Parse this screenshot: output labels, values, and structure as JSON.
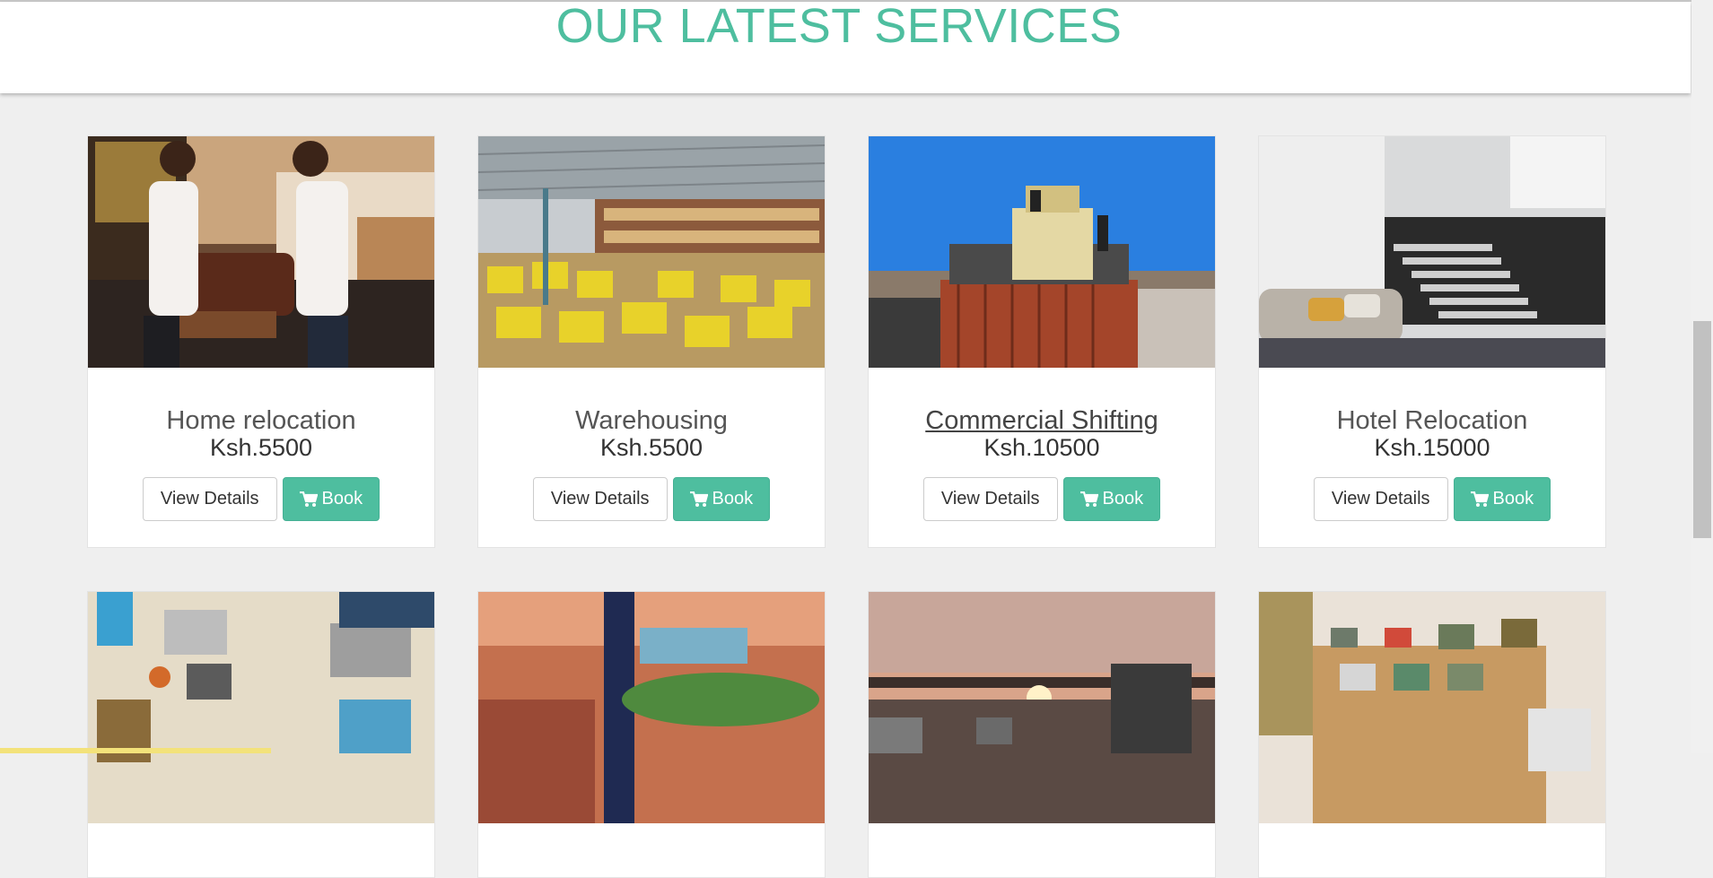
{
  "section": {
    "title": "OUR LATEST SERVICES"
  },
  "buttons": {
    "details_label": "View Details",
    "book_label": "Book"
  },
  "services": [
    {
      "title": "Home relocation",
      "price": "Ksh.5500",
      "image": "movers-carrying-sofa"
    },
    {
      "title": "Warehousing",
      "price": "Ksh.5500",
      "image": "warehouse-shelves"
    },
    {
      "title": "Commercial Shifting",
      "price": "Ksh.10500",
      "image": "loaded-truck"
    },
    {
      "title": "Hotel Relocation",
      "price": "Ksh.15000",
      "image": "hotel-lobby-stairs"
    }
  ],
  "row2_images": [
    "desk-with-laptops",
    "plant-restaurant",
    "highway-sunset",
    "retro-tv-shelf"
  ],
  "colors": {
    "accent": "#4ebe9f",
    "background": "#efefef"
  }
}
